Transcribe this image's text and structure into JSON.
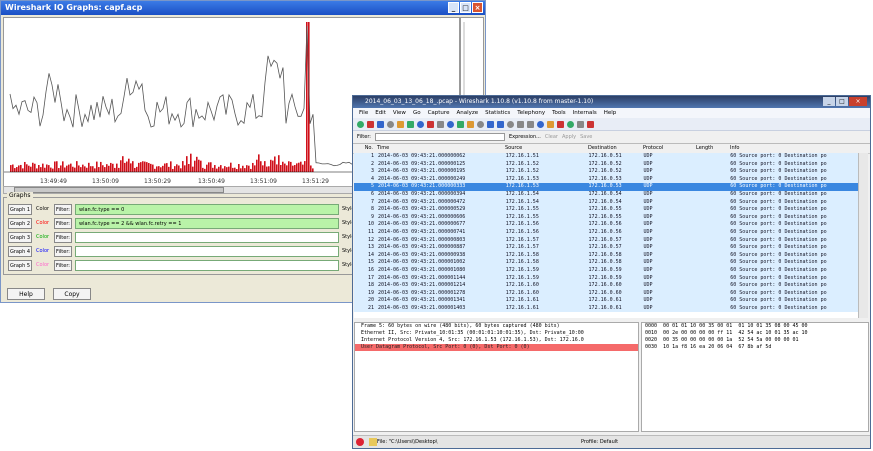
{
  "io_graph": {
    "title": "Wireshark IO Graphs: capf.acp",
    "x_ticks": [
      "13:49:49",
      "13:50:09",
      "13:50:29",
      "13:50:49",
      "13:51:09",
      "13:51:29"
    ],
    "graphs_label": "Graphs",
    "rows": [
      {
        "button": "Graph 1",
        "color": "Color",
        "filter_btn": "Filter:",
        "filter": "wlan.fc.type == 0",
        "style": "Style:",
        "active": true,
        "color_hex": "#000000"
      },
      {
        "button": "Graph 2",
        "color": "Color",
        "filter_btn": "Filter:",
        "filter": "wlan.fc.type == 2 && wlan.fc.retry == 1",
        "style": "Style:",
        "active": true,
        "color_hex": "#ff0000"
      },
      {
        "button": "Graph 3",
        "color": "Color",
        "filter_btn": "Filter:",
        "filter": "",
        "style": "Style:",
        "active": false,
        "color_hex": "#00aa00"
      },
      {
        "button": "Graph 4",
        "color": "Color",
        "filter_btn": "Filter:",
        "filter": "",
        "style": "Style:",
        "active": false,
        "color_hex": "#0000ff"
      },
      {
        "button": "Graph 5",
        "color": "Color",
        "filter_btn": "Filter:",
        "filter": "",
        "style": "Style:",
        "active": false,
        "color_hex": "#ff66cc"
      }
    ],
    "help_label": "Help",
    "copy_label": "Copy"
  },
  "wireshark": {
    "title": "2014_06_03_13_06_18_.pcap - Wireshark 1.10.8 (v1.10.8 from master-1.10)",
    "menu": [
      "File",
      "Edit",
      "View",
      "Go",
      "Capture",
      "Analyze",
      "Statistics",
      "Telephony",
      "Tools",
      "Internals",
      "Help"
    ],
    "filter_label": "Filter:",
    "filter_actions": [
      "Expression...",
      "Clear",
      "Apply",
      "Save"
    ],
    "columns": [
      "No.",
      "Time",
      "Source",
      "Destination",
      "Protocol",
      "Length",
      "Info"
    ],
    "packets": [
      [
        "1",
        "2014-06-03 09:43:21.000000062",
        "172.16.1.51",
        "172.16.0.51",
        "UDP",
        "",
        "60 Source port: 0  Destination po"
      ],
      [
        "2",
        "2014-06-03 09:43:21.000000125",
        "172.16.1.52",
        "172.16.0.52",
        "UDP",
        "",
        "60 Source port: 0  Destination po"
      ],
      [
        "3",
        "2014-06-03 09:43:21.000000195",
        "172.16.1.52",
        "172.16.0.52",
        "UDP",
        "",
        "60 Source port: 0  Destination po"
      ],
      [
        "4",
        "2014-06-03 09:43:21.000000249",
        "172.16.1.53",
        "172.16.0.53",
        "UDP",
        "",
        "60 Source port: 0  Destination po"
      ],
      [
        "5",
        "2014-06-03 09:43:21.000000333",
        "172.16.1.53",
        "172.16.0.53",
        "UDP",
        "",
        "60 Source port: 0  Destination po"
      ],
      [
        "6",
        "2014-06-03 09:43:21.000000394",
        "172.16.1.54",
        "172.16.0.54",
        "UDP",
        "",
        "60 Source port: 0  Destination po"
      ],
      [
        "7",
        "2014-06-03 09:43:21.000000472",
        "172.16.1.54",
        "172.16.0.54",
        "UDP",
        "",
        "60 Source port: 0  Destination po"
      ],
      [
        "8",
        "2014-06-03 09:43:21.000000529",
        "172.16.1.55",
        "172.16.0.55",
        "UDP",
        "",
        "60 Source port: 0  Destination po"
      ],
      [
        "9",
        "2014-06-03 09:43:21.000000606",
        "172.16.1.55",
        "172.16.0.55",
        "UDP",
        "",
        "60 Source port: 0  Destination po"
      ],
      [
        "10",
        "2014-06-03 09:43:21.000000677",
        "172.16.1.56",
        "172.16.0.56",
        "UDP",
        "",
        "60 Source port: 0  Destination po"
      ],
      [
        "11",
        "2014-06-03 09:43:21.000000741",
        "172.16.1.56",
        "172.16.0.56",
        "UDP",
        "",
        "60 Source port: 0  Destination po"
      ],
      [
        "12",
        "2014-06-03 09:43:21.000000803",
        "172.16.1.57",
        "172.16.0.57",
        "UDP",
        "",
        "60 Source port: 0  Destination po"
      ],
      [
        "13",
        "2014-06-03 09:43:21.000000887",
        "172.16.1.57",
        "172.16.0.57",
        "UDP",
        "",
        "60 Source port: 0  Destination po"
      ],
      [
        "14",
        "2014-06-03 09:43:21.000000938",
        "172.16.1.58",
        "172.16.0.58",
        "UDP",
        "",
        "60 Source port: 0  Destination po"
      ],
      [
        "15",
        "2014-06-03 09:43:21.000001002",
        "172.16.1.58",
        "172.16.0.58",
        "UDP",
        "",
        "60 Source port: 0  Destination po"
      ],
      [
        "16",
        "2014-06-03 09:43:21.000001080",
        "172.16.1.59",
        "172.16.0.59",
        "UDP",
        "",
        "60 Source port: 0  Destination po"
      ],
      [
        "17",
        "2014-06-03 09:43:21.000001144",
        "172.16.1.59",
        "172.16.0.59",
        "UDP",
        "",
        "60 Source port: 0  Destination po"
      ],
      [
        "18",
        "2014-06-03 09:43:21.000001214",
        "172.16.1.60",
        "172.16.0.60",
        "UDP",
        "",
        "60 Source port: 0  Destination po"
      ],
      [
        "19",
        "2014-06-03 09:43:21.000001278",
        "172.16.1.60",
        "172.16.0.60",
        "UDP",
        "",
        "60 Source port: 0  Destination po"
      ],
      [
        "20",
        "2014-06-03 09:43:21.000001341",
        "172.16.1.61",
        "172.16.0.61",
        "UDP",
        "",
        "60 Source port: 0  Destination po"
      ],
      [
        "21",
        "2014-06-03 09:43:21.000001403",
        "172.16.1.61",
        "172.16.0.61",
        "UDP",
        "",
        "60 Source port: 0  Destination po"
      ]
    ],
    "selected_row": 4,
    "details": [
      "Frame 5: 60 bytes on wire (480 bits), 60 bytes captured (480 bits)",
      "Ethernet II, Src: Private_10:01:35 (00:01:01:10:01:35), Dst: Private_10:00",
      "Internet Protocol Version 4, Src: 172.16.1.53 (172.16.1.53), Dst: 172.16.0",
      "User Datagram Protocol, Src Port: 0 (0), Dst Port: 0 (0)"
    ],
    "hex": [
      "0000  00 01 01 10 00 35 00 01  01 10 01 35 08 00 45 00",
      "0010  00 2e 00 00 00 00 ff 11  42 54 ac 10 01 35 ac 10",
      "0020  00 35 00 00 00 00 00 1a  52 54 5a 00 00 00 01",
      "0030  10 1a f8 16 ea 20 06 04  67 8b af 5d"
    ],
    "status_file": "File: \"C:\\Users\\\\Desktop\\",
    "status_profile": "Profile: Default"
  }
}
